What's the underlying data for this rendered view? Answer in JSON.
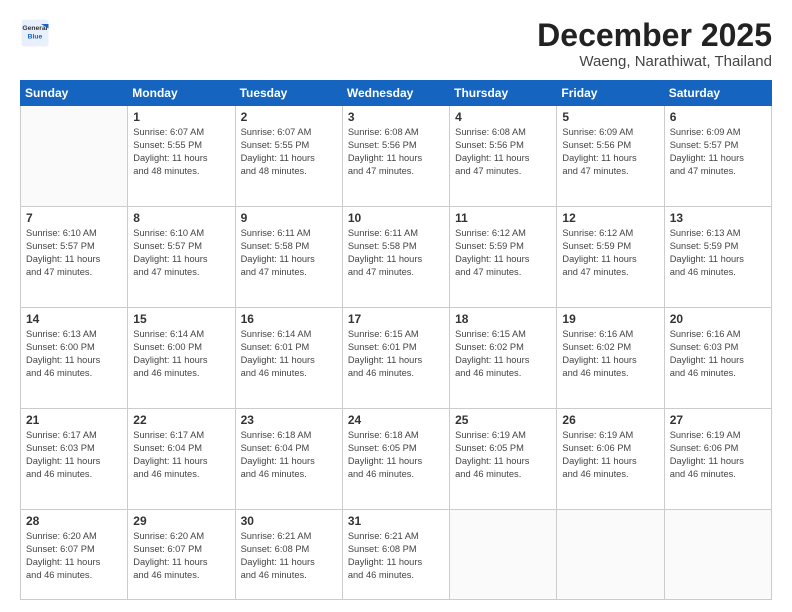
{
  "header": {
    "logo_line1": "General",
    "logo_line2": "Blue",
    "month": "December 2025",
    "location": "Waeng, Narathiwat, Thailand"
  },
  "weekdays": [
    "Sunday",
    "Monday",
    "Tuesday",
    "Wednesday",
    "Thursday",
    "Friday",
    "Saturday"
  ],
  "weeks": [
    [
      {
        "day": "",
        "text": ""
      },
      {
        "day": "1",
        "text": "Sunrise: 6:07 AM\nSunset: 5:55 PM\nDaylight: 11 hours\nand 48 minutes."
      },
      {
        "day": "2",
        "text": "Sunrise: 6:07 AM\nSunset: 5:55 PM\nDaylight: 11 hours\nand 48 minutes."
      },
      {
        "day": "3",
        "text": "Sunrise: 6:08 AM\nSunset: 5:56 PM\nDaylight: 11 hours\nand 47 minutes."
      },
      {
        "day": "4",
        "text": "Sunrise: 6:08 AM\nSunset: 5:56 PM\nDaylight: 11 hours\nand 47 minutes."
      },
      {
        "day": "5",
        "text": "Sunrise: 6:09 AM\nSunset: 5:56 PM\nDaylight: 11 hours\nand 47 minutes."
      },
      {
        "day": "6",
        "text": "Sunrise: 6:09 AM\nSunset: 5:57 PM\nDaylight: 11 hours\nand 47 minutes."
      }
    ],
    [
      {
        "day": "7",
        "text": "Sunrise: 6:10 AM\nSunset: 5:57 PM\nDaylight: 11 hours\nand 47 minutes."
      },
      {
        "day": "8",
        "text": "Sunrise: 6:10 AM\nSunset: 5:57 PM\nDaylight: 11 hours\nand 47 minutes."
      },
      {
        "day": "9",
        "text": "Sunrise: 6:11 AM\nSunset: 5:58 PM\nDaylight: 11 hours\nand 47 minutes."
      },
      {
        "day": "10",
        "text": "Sunrise: 6:11 AM\nSunset: 5:58 PM\nDaylight: 11 hours\nand 47 minutes."
      },
      {
        "day": "11",
        "text": "Sunrise: 6:12 AM\nSunset: 5:59 PM\nDaylight: 11 hours\nand 47 minutes."
      },
      {
        "day": "12",
        "text": "Sunrise: 6:12 AM\nSunset: 5:59 PM\nDaylight: 11 hours\nand 47 minutes."
      },
      {
        "day": "13",
        "text": "Sunrise: 6:13 AM\nSunset: 5:59 PM\nDaylight: 11 hours\nand 46 minutes."
      }
    ],
    [
      {
        "day": "14",
        "text": "Sunrise: 6:13 AM\nSunset: 6:00 PM\nDaylight: 11 hours\nand 46 minutes."
      },
      {
        "day": "15",
        "text": "Sunrise: 6:14 AM\nSunset: 6:00 PM\nDaylight: 11 hours\nand 46 minutes."
      },
      {
        "day": "16",
        "text": "Sunrise: 6:14 AM\nSunset: 6:01 PM\nDaylight: 11 hours\nand 46 minutes."
      },
      {
        "day": "17",
        "text": "Sunrise: 6:15 AM\nSunset: 6:01 PM\nDaylight: 11 hours\nand 46 minutes."
      },
      {
        "day": "18",
        "text": "Sunrise: 6:15 AM\nSunset: 6:02 PM\nDaylight: 11 hours\nand 46 minutes."
      },
      {
        "day": "19",
        "text": "Sunrise: 6:16 AM\nSunset: 6:02 PM\nDaylight: 11 hours\nand 46 minutes."
      },
      {
        "day": "20",
        "text": "Sunrise: 6:16 AM\nSunset: 6:03 PM\nDaylight: 11 hours\nand 46 minutes."
      }
    ],
    [
      {
        "day": "21",
        "text": "Sunrise: 6:17 AM\nSunset: 6:03 PM\nDaylight: 11 hours\nand 46 minutes."
      },
      {
        "day": "22",
        "text": "Sunrise: 6:17 AM\nSunset: 6:04 PM\nDaylight: 11 hours\nand 46 minutes."
      },
      {
        "day": "23",
        "text": "Sunrise: 6:18 AM\nSunset: 6:04 PM\nDaylight: 11 hours\nand 46 minutes."
      },
      {
        "day": "24",
        "text": "Sunrise: 6:18 AM\nSunset: 6:05 PM\nDaylight: 11 hours\nand 46 minutes."
      },
      {
        "day": "25",
        "text": "Sunrise: 6:19 AM\nSunset: 6:05 PM\nDaylight: 11 hours\nand 46 minutes."
      },
      {
        "day": "26",
        "text": "Sunrise: 6:19 AM\nSunset: 6:06 PM\nDaylight: 11 hours\nand 46 minutes."
      },
      {
        "day": "27",
        "text": "Sunrise: 6:19 AM\nSunset: 6:06 PM\nDaylight: 11 hours\nand 46 minutes."
      }
    ],
    [
      {
        "day": "28",
        "text": "Sunrise: 6:20 AM\nSunset: 6:07 PM\nDaylight: 11 hours\nand 46 minutes."
      },
      {
        "day": "29",
        "text": "Sunrise: 6:20 AM\nSunset: 6:07 PM\nDaylight: 11 hours\nand 46 minutes."
      },
      {
        "day": "30",
        "text": "Sunrise: 6:21 AM\nSunset: 6:08 PM\nDaylight: 11 hours\nand 46 minutes."
      },
      {
        "day": "31",
        "text": "Sunrise: 6:21 AM\nSunset: 6:08 PM\nDaylight: 11 hours\nand 46 minutes."
      },
      {
        "day": "",
        "text": ""
      },
      {
        "day": "",
        "text": ""
      },
      {
        "day": "",
        "text": ""
      }
    ]
  ]
}
